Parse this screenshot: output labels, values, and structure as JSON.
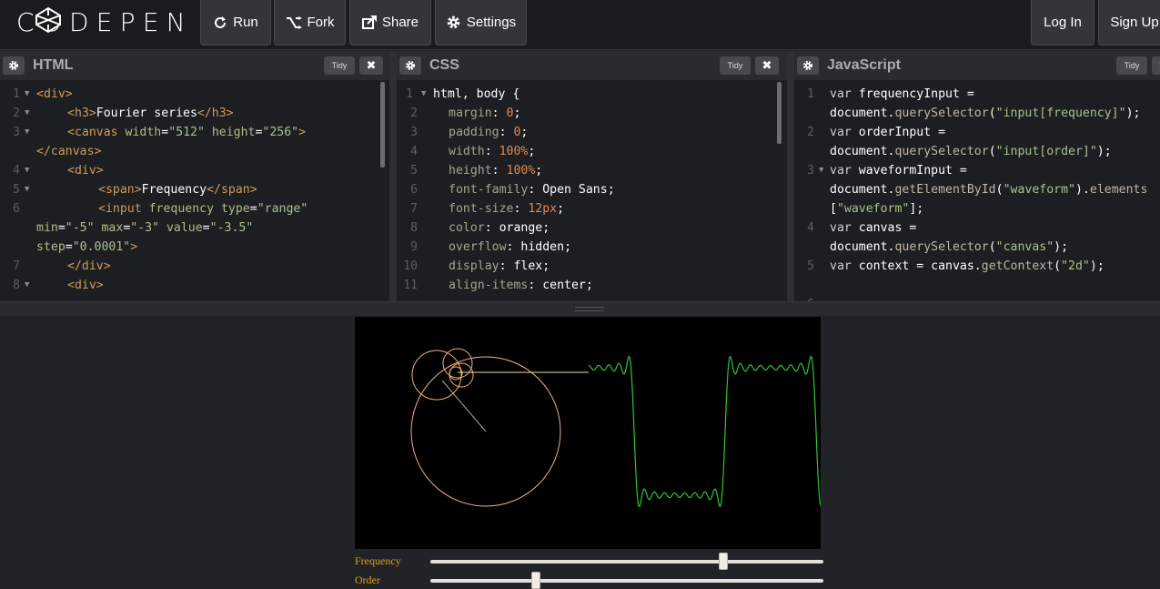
{
  "header": {
    "logo_text": "CODEPEN",
    "run_label": "Run",
    "fork_label": "Fork",
    "share_label": "Share",
    "settings_label": "Settings",
    "login_label": "Log In",
    "signup_label": "Sign Up"
  },
  "editors": {
    "html_title": "HTML",
    "css_title": "CSS",
    "js_title": "JavaScript",
    "tidy_label": "Tidy",
    "close_glyph": "✖"
  },
  "html_code": {
    "l1": "<div>",
    "l2a": "<h3>",
    "l2b": "Fourier series",
    "l2c": "</h3>",
    "l3a": "<canvas ",
    "l3b": "width",
    "l3c": "=",
    "l3d": "\"512\"",
    "l3e": " height",
    "l3f": "=",
    "l3g": "\"256\"",
    "l3h": ">",
    "l3w": "</canvas>",
    "l4": "<div>",
    "l5a": "<span>",
    "l5b": "Frequency",
    "l5c": "</span>",
    "l6a": "<input ",
    "l6b": "frequency",
    "l6c": " type",
    "l6d": "=",
    "l6e": "\"range\"",
    "l6w1a": "min",
    "l6w1b": "=",
    "l6w1c": "\"-5\"",
    "l6w1d": " max",
    "l6w1e": "=",
    "l6w1f": "\"-3\"",
    "l6w1g": " value",
    "l6w1h": "=",
    "l6w1i": "\"-3.5\"",
    "l6w2a": "step",
    "l6w2b": "=",
    "l6w2c": "\"0.0001\"",
    "l6w2d": ">",
    "l7": "</div>",
    "l8": "<div>"
  },
  "css_code": {
    "l1": "html, body {",
    "l2a": "margin",
    "l2b": ": ",
    "l2c": "0",
    "l2d": ";",
    "l3a": "padding",
    "l3b": ": ",
    "l3c": "0",
    "l3d": ";",
    "l4a": "width",
    "l4b": ": ",
    "l4c": "100%",
    "l4d": ";",
    "l5a": "height",
    "l5b": ": ",
    "l5c": "100%",
    "l5d": ";",
    "l6a": "font-family",
    "l6b": ": ",
    "l6c": "Open Sans",
    "l6d": ";",
    "l7a": "font-size",
    "l7b": ": ",
    "l7c": "12px",
    "l7d": ";",
    "l8a": "color",
    "l8b": ": ",
    "l8c": "orange",
    "l8d": ";",
    "l9a": "overflow",
    "l9b": ": ",
    "l9c": "hidden",
    "l9d": ";",
    "l10a": "display",
    "l10b": ": ",
    "l10c": "flex",
    "l10d": ";",
    "l11a": "align-items",
    "l11b": ": ",
    "l11c": "center",
    "l11d": ";"
  },
  "js_code": {
    "l1a": "var ",
    "l1b": "frequencyInput",
    "l1c": " =",
    "l1w": "document.",
    "l1wb": "querySelector",
    "l1wc": "(",
    "l1wd": "\"input[frequency]\"",
    "l1we": ");",
    "l2a": "var ",
    "l2b": "orderInput",
    "l2c": " =",
    "l2w": "document.",
    "l2wb": "querySelector",
    "l2wc": "(",
    "l2wd": "\"input[order]\"",
    "l2we": ");",
    "l3a": "var ",
    "l3b": "waveformInput",
    "l3c": " =",
    "l3w": "document.",
    "l3wb": "getElementById",
    "l3wc": "(",
    "l3wd": "\"waveform\"",
    "l3we": ").",
    "l3wf": "elements",
    "l3w2a": "[",
    "l3w2b": "\"waveform\"",
    "l3w2c": "];",
    "l4a": "var ",
    "l4b": "canvas",
    "l4c": " =",
    "l4w": "document.",
    "l4wb": "querySelector",
    "l4wc": "(",
    "l4wd": "\"canvas\"",
    "l4we": ");",
    "l5a": "var ",
    "l5b": "context",
    "l5c": " = ",
    "l5d": "canvas.",
    "l5e": "getContext",
    "l5f": "(",
    "l5g": "\"2d\"",
    "l5h": ");"
  },
  "line_numbers": [
    "1",
    "2",
    "3",
    "4",
    "5",
    "6",
    "7",
    "8",
    "9",
    "10",
    "11"
  ],
  "preview": {
    "frequency_label": "Frequency",
    "order_label": "Order",
    "frequency": {
      "min": -5,
      "max": -3,
      "value": -3.5
    },
    "order_fraction": 0.25
  },
  "colors": {
    "circle": "#f4b07a",
    "wave": "#2fc42f",
    "line": "#e6e08c"
  }
}
